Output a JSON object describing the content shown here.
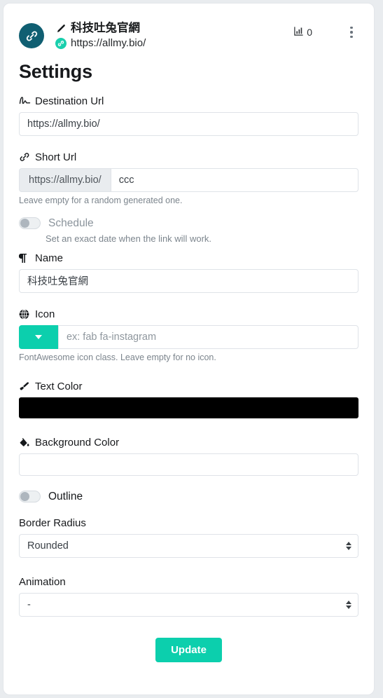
{
  "header": {
    "avatar_icon": "link-icon",
    "pencil_icon": "pencil-icon",
    "title": "科技吐兔官網",
    "mini_link_icon": "link-icon",
    "url": "https://allmy.bio/",
    "stats_icon": "bar-chart-icon",
    "stats_count": "0",
    "menu_icon": "kebab-menu-icon"
  },
  "page": {
    "title": "Settings"
  },
  "form": {
    "destination_url": {
      "icon": "signature-icon",
      "label": "Destination Url",
      "value": "https://allmy.bio/"
    },
    "short_url": {
      "icon": "link-icon",
      "label": "Short Url",
      "prefix": "https://allmy.bio/",
      "value": "ccc",
      "helper": "Leave empty for a random generated one."
    },
    "schedule": {
      "label": "Schedule",
      "enabled": false,
      "note": "Set an exact date when the link will work."
    },
    "name": {
      "icon": "paragraph-icon",
      "label": "Name",
      "value": "科技吐兔官網"
    },
    "icon_field": {
      "icon": "globe-icon",
      "label": "Icon",
      "dropdown_icon": "chevron-down-icon",
      "placeholder": "ex: fab fa-instagram",
      "value": "",
      "helper": "FontAwesome icon class. Leave empty for no icon."
    },
    "text_color": {
      "icon": "paint-brush-icon",
      "label": "Text Color",
      "value": "#000000"
    },
    "background_color": {
      "icon": "paint-bucket-icon",
      "label": "Background Color",
      "value": ""
    },
    "outline": {
      "label": "Outline",
      "enabled": false
    },
    "border_radius": {
      "label": "Border Radius",
      "value": "Rounded",
      "options": [
        "Rounded"
      ]
    },
    "animation": {
      "label": "Animation",
      "value": "-",
      "options": [
        "-"
      ]
    },
    "submit": {
      "label": "Update"
    }
  },
  "colors": {
    "accent": "#0ccfad",
    "avatar": "#105f72",
    "mini_link": "#19cfad",
    "text_color_swatch": "#000000"
  }
}
